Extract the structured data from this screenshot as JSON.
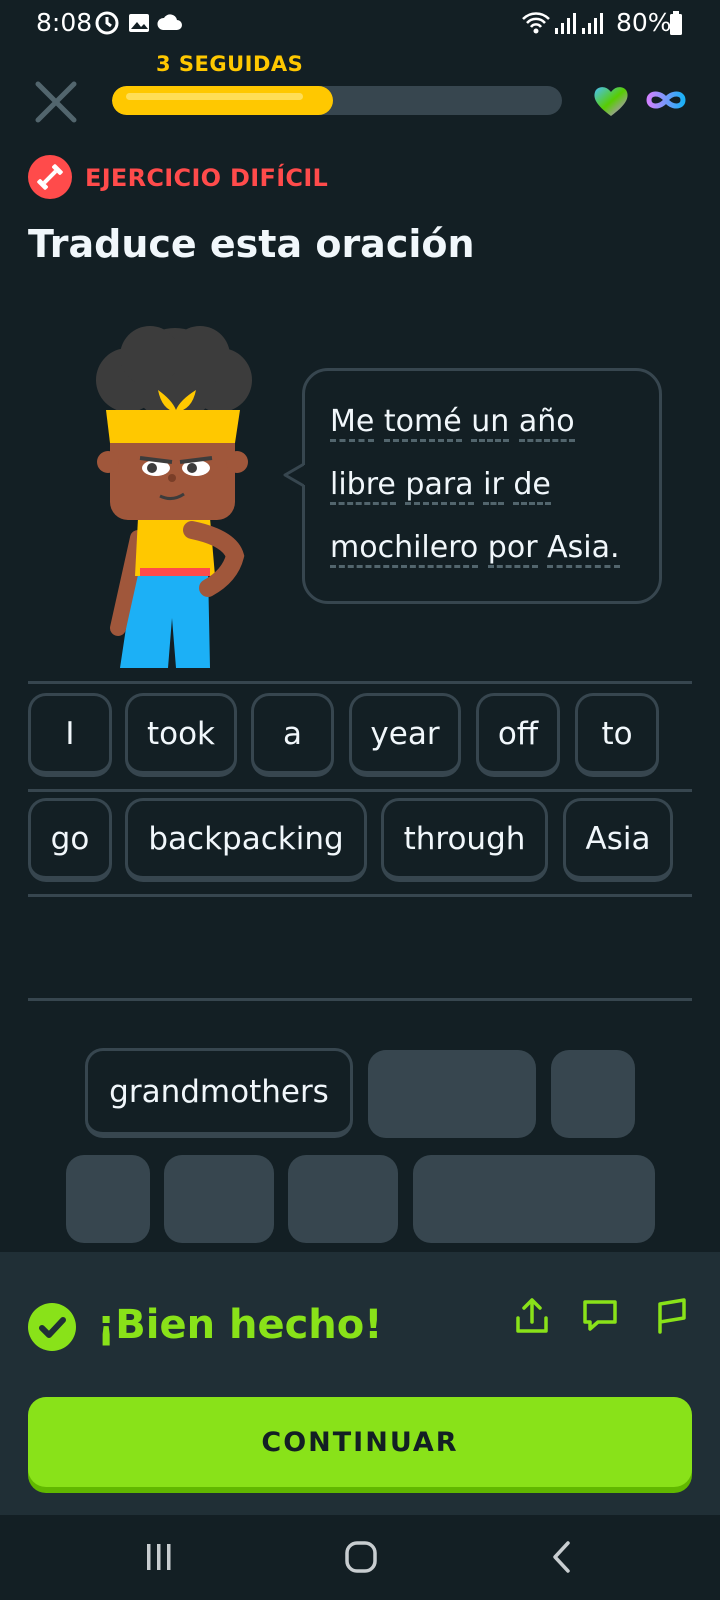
{
  "status_bar": {
    "time": "8:08",
    "battery": "80%",
    "icons": [
      "sync-icon",
      "image-icon",
      "cloud-icon",
      "wifi-icon",
      "signal-icon",
      "signal-icon",
      "battery-icon"
    ]
  },
  "top_bar": {
    "streak_label": "3 SEGUIDAS",
    "progress": 0.49,
    "accent_color": "#ffc800"
  },
  "exercise": {
    "badge_label": "EJERCICIO DIFÍCIL",
    "title": "Traduce esta oración",
    "sentence_lines": [
      [
        "Me",
        "tomé",
        "un",
        "año"
      ],
      [
        "libre",
        "para",
        "ir",
        "de"
      ],
      [
        "mochilero",
        "por",
        "Asia."
      ]
    ]
  },
  "answer": {
    "row1": [
      "I",
      "took",
      "a",
      "year",
      "off",
      "to"
    ],
    "row2": [
      "go",
      "backpacking",
      "through",
      "Asia"
    ]
  },
  "word_bank": {
    "visible_words": [
      "grandmothers"
    ]
  },
  "feedback": {
    "message": "¡Bien hecho!",
    "continue_label": "CONTINUAR",
    "success_color": "#89e219"
  }
}
